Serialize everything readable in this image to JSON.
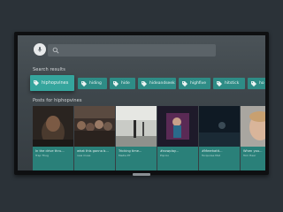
{
  "search": {
    "placeholder": ""
  },
  "search_results_label": "Search results",
  "chips": [
    {
      "label": "hiphopvines",
      "focused": true
    },
    {
      "label": "hiding",
      "focused": false
    },
    {
      "label": "hide",
      "focused": false
    },
    {
      "label": "hideandseek",
      "focused": false
    },
    {
      "label": "highfive",
      "focused": false
    },
    {
      "label": "hitstick",
      "focused": false
    },
    {
      "label": "ho",
      "focused": false
    }
  ],
  "posts_label": "Posts for hiphopvines",
  "posts": [
    {
      "title": "In the drive thru...",
      "subtitle": "Trap Thug"
    },
    {
      "title": "what this gonna b...",
      "subtitle": "new muse"
    },
    {
      "title": "Tricking time...",
      "subtitle": "Media ET"
    },
    {
      "title": "#nowplay...",
      "subtitle": "Pop bo"
    },
    {
      "title": "#Meerkatit...",
      "subtitle": "Turquoise Mat"
    },
    {
      "title": "When you...",
      "subtitle": "Tom Haer"
    }
  ],
  "colors": {
    "chip": "#2e8c86",
    "chip_focused": "#35a59d",
    "card": "#2a8079"
  }
}
